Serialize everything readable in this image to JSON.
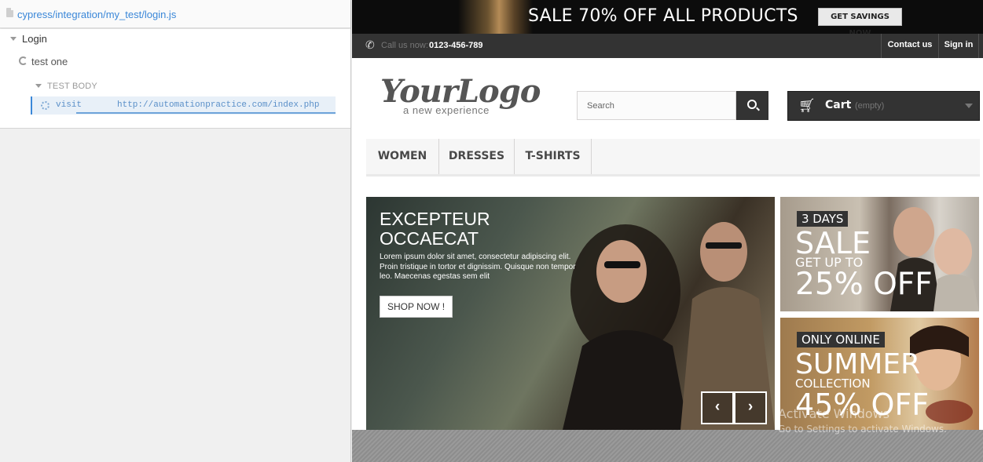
{
  "runner": {
    "spec_path": "cypress/integration/my_test/login.js",
    "suite_title": "Login",
    "test_title": "test one",
    "section_label": "TEST BODY",
    "command": {
      "name": "visit",
      "message": "http://automationpractice.com/index.php"
    }
  },
  "site": {
    "promo": {
      "text": "SALE 70% OFF ALL PRODUCTS",
      "button": "GET SAVINGS NOW"
    },
    "nav": {
      "call_label": "Call us now:",
      "call_number": "0123-456-789",
      "contact": "Contact us",
      "signin": "Sign in"
    },
    "logo": {
      "main": "YourLogo",
      "sub": "a new experience"
    },
    "search": {
      "placeholder": "Search"
    },
    "cart": {
      "label": "Cart",
      "status": "(empty)"
    },
    "menu": [
      "WOMEN",
      "DRESSES",
      "T-SHIRTS"
    ],
    "slider": {
      "title": "EXCEPTEUR OCCAECAT",
      "text": "Lorem ipsum dolor sit amet, consectetur adipiscing elit. Proin tristique in tortor et dignissim. Quisque non tempor leo. Maecenas egestas sem elit",
      "button": "SHOP NOW !",
      "prev": "‹",
      "next": "›"
    },
    "banner1": {
      "tag": "3 DAYS",
      "big": "SALE",
      "sub": "GET UP TO",
      "pct": "25% OFF"
    },
    "banner2": {
      "tag": "ONLY ONLINE",
      "big": "SUMMER",
      "sub": "COLLECTION",
      "pct": "45% OFF"
    }
  },
  "os_watermark": {
    "title": "Activate Windows",
    "subtitle": "Go to Settings to activate Windows."
  },
  "colors": {
    "runner_link": "#3a87d8",
    "site_dark": "#333333",
    "promo_bg": "#0c0c0c"
  },
  "icons": {
    "file": "file-icon",
    "refresh": "refresh-icon",
    "spinner": "spinner-icon",
    "phone": "phone-icon",
    "search": "search-icon",
    "cart": "cart-icon"
  }
}
